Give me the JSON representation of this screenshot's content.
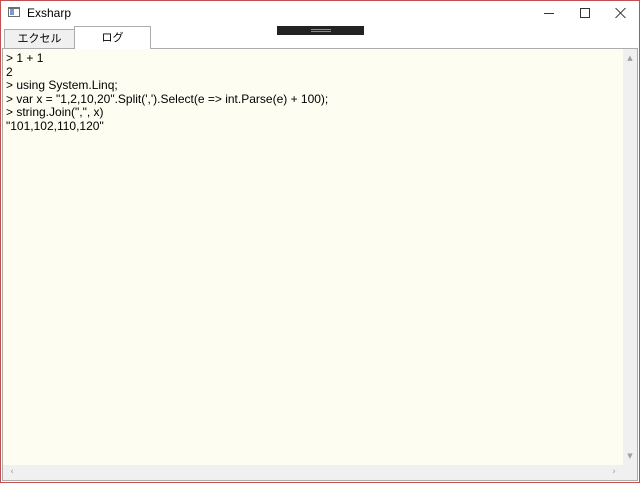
{
  "window": {
    "title": "Exsharp"
  },
  "tabs": [
    {
      "label": "エクセル"
    },
    {
      "label": "ログ"
    }
  ],
  "log": {
    "lines": [
      "> 1 + 1",
      "2",
      "> using System.Linq;",
      "> var x = \"1,2,10,20\".Split(',').Select(e => int.Parse(e) + 100);",
      "> string.Join(\",\", x)",
      "\"101,102,110,120\""
    ]
  },
  "icons": {
    "minimize": "minimize-icon",
    "maximize": "maximize-icon",
    "close": "close-icon",
    "app": "app-window-icon"
  },
  "colors": {
    "log_background": "#fdfdf2",
    "window_border": "#c0504d"
  }
}
